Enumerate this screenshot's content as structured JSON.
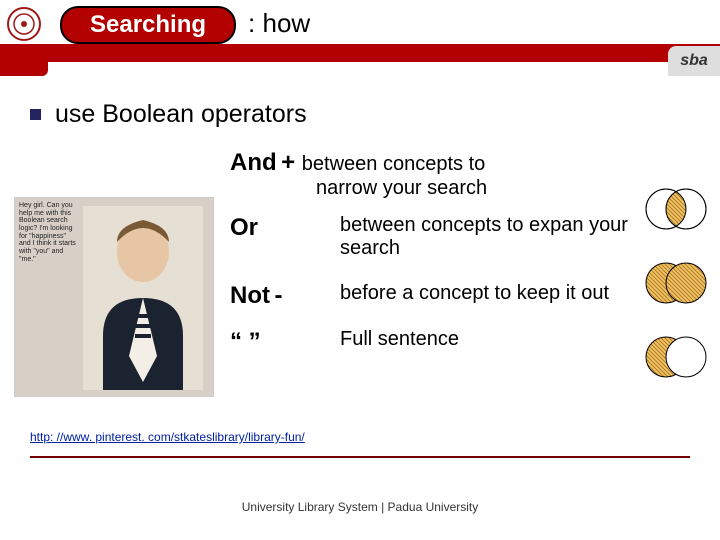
{
  "header": {
    "tab_label": "Searching",
    "subtitle": " : how",
    "logo_right": "sba"
  },
  "main": {
    "heading": "use Boolean operators",
    "meme_caption": "Hey girl. Can you help me with this Boolean search logic? I'm looking for \"happiness\" and I think it starts with \"you\" and \"me.\"",
    "operators": [
      {
        "name": "And",
        "symbol": "+",
        "desc_before": "between concepts to",
        "desc_indent": "narrow your search"
      },
      {
        "name": "Or",
        "symbol": "",
        "desc": "between concepts to expan your search"
      },
      {
        "name": "Not",
        "symbol": "-",
        "desc": "before a concept to keep it out"
      },
      {
        "name": "“ ”",
        "symbol": "",
        "desc": "Full sentence"
      }
    ],
    "source_link": "http: //www. pinterest. com/stkateslibrary/library-fun/"
  },
  "footer": {
    "text": "University Library System | Padua University"
  }
}
